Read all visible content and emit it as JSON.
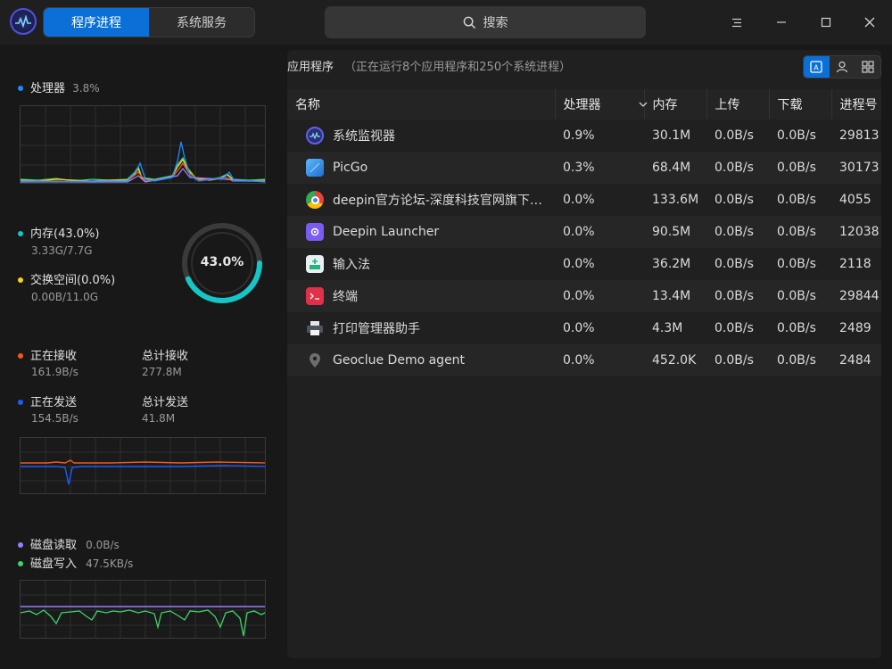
{
  "tabs": [
    {
      "label": "程序进程",
      "active": true
    },
    {
      "label": "系统服务",
      "active": false
    }
  ],
  "search": {
    "label": "搜索"
  },
  "sidebar": {
    "cpu": {
      "label": "处理器",
      "value": "3.8%",
      "color": "#1a8cff"
    },
    "memory": {
      "label": "内存(43.0%)",
      "value": "3.33G/7.7G",
      "color": "#16c5c5"
    },
    "swap": {
      "label": "交换空间(0.0%)",
      "value": "0.00B/11.0G",
      "color": "#f5d020"
    },
    "ring": {
      "percent_label": "43.0%",
      "percent": 43.0
    },
    "net": {
      "recv": {
        "label": "正在接收",
        "value": "161.9B/s",
        "color": "#f05a1a"
      },
      "total_recv": {
        "label": "总计接收",
        "value": "277.8M"
      },
      "send": {
        "label": "正在发送",
        "value": "154.5B/s",
        "color": "#1a5cff"
      },
      "total_send": {
        "label": "总计发送",
        "value": "41.8M"
      }
    },
    "disk": {
      "read": {
        "label": "磁盘读取",
        "value": "0.0B/s",
        "color": "#9a7cff"
      },
      "write": {
        "label": "磁盘写入",
        "value": "47.5KB/s",
        "color": "#3fd36a"
      }
    }
  },
  "main": {
    "title": "应用程序",
    "subtitle": "（正在运行8个应用程序和250个系统进程）",
    "columns": [
      "名称",
      "处理器",
      "内存",
      "上传",
      "下载",
      "进程号"
    ],
    "rows": [
      {
        "icon": "system-monitor-icon",
        "name": "系统监视器",
        "cpu": "0.9%",
        "mem": "30.1M",
        "up": "0.0B/s",
        "down": "0.0B/s",
        "pid": "29813"
      },
      {
        "icon": "picgo-icon",
        "name": "PicGo",
        "cpu": "0.3%",
        "mem": "68.4M",
        "up": "0.0B/s",
        "down": "0.0B/s",
        "pid": "30173"
      },
      {
        "icon": "chrome-icon",
        "name": "deepin官方论坛-深度科技官网旗下…",
        "cpu": "0.0%",
        "mem": "133.6M",
        "up": "0.0B/s",
        "down": "0.0B/s",
        "pid": "4055"
      },
      {
        "icon": "launcher-icon",
        "name": "Deepin Launcher",
        "cpu": "0.0%",
        "mem": "90.5M",
        "up": "0.0B/s",
        "down": "0.0B/s",
        "pid": "12038"
      },
      {
        "icon": "input-method-icon",
        "name": "输入法",
        "cpu": "0.0%",
        "mem": "36.2M",
        "up": "0.0B/s",
        "down": "0.0B/s",
        "pid": "2118"
      },
      {
        "icon": "terminal-icon",
        "name": "终端",
        "cpu": "0.0%",
        "mem": "13.4M",
        "up": "0.0B/s",
        "down": "0.0B/s",
        "pid": "29844"
      },
      {
        "icon": "printer-icon",
        "name": "打印管理器助手",
        "cpu": "0.0%",
        "mem": "4.3M",
        "up": "0.0B/s",
        "down": "0.0B/s",
        "pid": "2489"
      },
      {
        "icon": "location-pin-icon",
        "name": "Geoclue Demo agent",
        "cpu": "0.0%",
        "mem": "452.0K",
        "up": "0.0B/s",
        "down": "0.0B/s",
        "pid": "2484"
      }
    ]
  }
}
